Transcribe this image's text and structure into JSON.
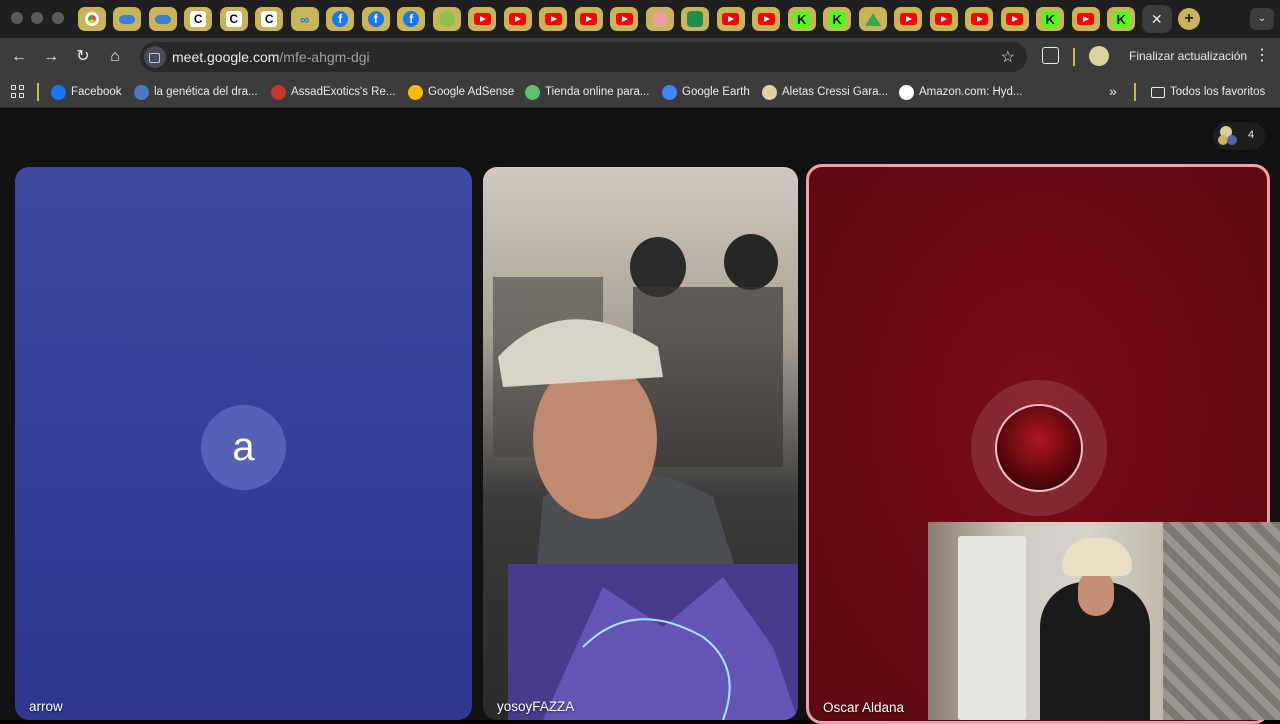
{
  "browser": {
    "tabs": [
      {
        "icon": "chrome-icon"
      },
      {
        "icon": "cloud-icon"
      },
      {
        "icon": "cloud-icon"
      },
      {
        "icon": "g-icon",
        "glyph": "C"
      },
      {
        "icon": "g-icon",
        "glyph": "C"
      },
      {
        "icon": "g-icon",
        "glyph": "C"
      },
      {
        "icon": "meta-icon",
        "glyph": "∞"
      },
      {
        "icon": "facebook-icon",
        "glyph": "f"
      },
      {
        "icon": "facebook-icon",
        "glyph": "f"
      },
      {
        "icon": "facebook-icon",
        "glyph": "f"
      },
      {
        "icon": "green-circle-icon"
      },
      {
        "icon": "youtube-icon"
      },
      {
        "icon": "youtube-icon"
      },
      {
        "icon": "youtube-icon"
      },
      {
        "icon": "youtube-icon"
      },
      {
        "icon": "youtube-icon"
      },
      {
        "icon": "pink-circle-icon"
      },
      {
        "icon": "tree-icon"
      },
      {
        "icon": "youtube-icon"
      },
      {
        "icon": "youtube-icon"
      },
      {
        "icon": "kick-icon",
        "glyph": "K"
      },
      {
        "icon": "kick-icon",
        "glyph": "K"
      },
      {
        "icon": "drive-icon"
      },
      {
        "icon": "youtube-icon"
      },
      {
        "icon": "youtube-icon"
      },
      {
        "icon": "youtube-icon"
      },
      {
        "icon": "youtube-icon"
      },
      {
        "icon": "kick-icon",
        "glyph": "K"
      },
      {
        "icon": "youtube-icon"
      },
      {
        "icon": "kick-icon",
        "glyph": "K"
      },
      {
        "icon": "close-icon",
        "glyph": "✕",
        "active": true
      }
    ],
    "new_tab_glyph": "+",
    "tab_search_glyph": "⌄",
    "nav": {
      "back": "←",
      "forward": "→",
      "reload": "↻",
      "home": "⌂"
    },
    "address": {
      "host": "meet.google.com",
      "path": "/mfe-ahgm-dgi"
    },
    "bookmark_star": "☆",
    "update_label": "Finalizar actualización",
    "menu_glyph": "⋮",
    "bookmarks": [
      {
        "label": "Facebook",
        "color": "#1877f2"
      },
      {
        "label": "la genética del dra...",
        "color": "#4a78c2"
      },
      {
        "label": "AssadExotics's Re...",
        "color": "#c0392b"
      },
      {
        "label": "Google AdSense",
        "color": "#fbbc04"
      },
      {
        "label": "Tienda online para...",
        "color": "#5fbf6a"
      },
      {
        "label": "Google Earth",
        "color": "#4285f4"
      },
      {
        "label": "Aletas Cressi Gara...",
        "color": "#e0d4a0"
      },
      {
        "label": "Amazon.com: Hyd...",
        "color": "#ffffff"
      }
    ],
    "bookmarks_more": "»",
    "all_bookmarks_label": "Todos los favoritos"
  },
  "meet": {
    "participant_count": "4",
    "tiles": {
      "arrow": {
        "name": "arrow",
        "initial": "a",
        "color": "#34409a"
      },
      "video": {
        "name": "yosoyFAZZA"
      },
      "oscar": {
        "name": "Oscar Aldana",
        "color": "#6a0a12",
        "speaking": true
      }
    }
  }
}
